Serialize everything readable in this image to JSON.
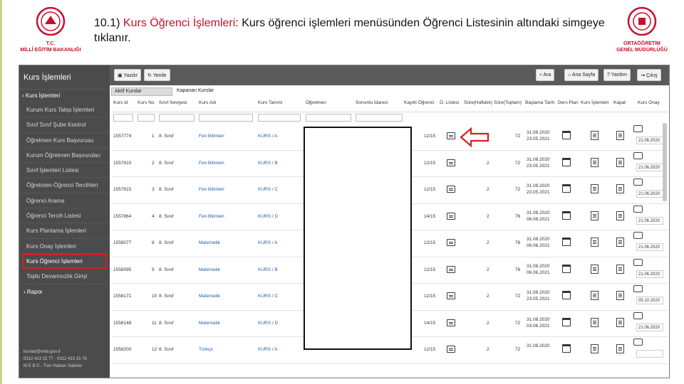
{
  "slide": {
    "headline_number": "10.1)",
    "headline_highlight": "Kurs Öğrenci İşlemleri",
    "headline_rest": ": Kurs öğrenci işlemleri menüsünden Öğrenci Listesinin altındaki simgeye tıklanır.",
    "logo_left_text1": "T.C.",
    "logo_left_text2": "MİLLÎ EĞİTİM BAKANLIĞI",
    "logo_right_text1": "ORTAÖĞRETİM",
    "logo_right_text2": "GENEL MÜDÜRLÜĞÜ"
  },
  "sidebar": {
    "title": "Kurs İşlemleri",
    "group": "Kurs İşlemleri",
    "items": [
      "Kurum Kurs Talep İşlemleri",
      "Sınıf Sınıf Şube Kontrol",
      "Öğretmen Kurs Başvurusu",
      "Kurum Öğretmen Başvuruları",
      "Sınıf İşlemleri Listesi",
      "Öğretmen-Öğrenci Tercihleri",
      "Öğrenci Arama",
      "Öğrenci Tercih Listesi",
      "Kurs Planlama İşlemleri",
      "Kurs Onay İşlemleri",
      "Kurs Öğrenci İşlemleri",
      "Toplu Devamsızlık Girişi"
    ],
    "active_index": 10,
    "rapor": "Rapor",
    "footer1": "kurslar@meb.gov.tr",
    "footer2": "0312 413 15 77 · 0312 413 15 78",
    "footer3": "M E B © - Tüm Hakları Saklıdır"
  },
  "toolbar": {
    "yazdir": "Yazdır",
    "yenile": "Yenile",
    "ara": "Ara",
    "ana_sayfa": "Ana Sayfa",
    "yardim": "Yardım",
    "cikis": "Çıkış"
  },
  "tabs": [
    "Aktif Kurslar",
    "Kapanan Kurslar"
  ],
  "table": {
    "headers": [
      "Kurs Id",
      "Kurs No",
      "Sınıf Seviyesi",
      "Kurs Adı",
      "Kurs Tanımı",
      "Öğretmen",
      "Sorumlu İdareci",
      "Kayıtlı Öğrenci",
      "Ö. Listesi",
      "Süre(Haftalık)",
      "Süre(Toplam)",
      "Başlama Tarih",
      "Ders Plan",
      "Kurs İşlemleri",
      "Kapat",
      "Kurs Onay"
    ],
    "rows": [
      {
        "id": "1557774",
        "no": "1",
        "seviye": "8. Sınıf",
        "ad": "Fen Bilimleri",
        "tanim": "KURS / A",
        "kayitli": "12/15",
        "haftalik": "2",
        "toplam": "72",
        "bas": "31.08.2020",
        "bit": "23.05.2021",
        "kapat": "21.06.2020"
      },
      {
        "id": "1557810",
        "no": "2",
        "seviye": "8. Sınıf",
        "ad": "Fen Bilimleri",
        "tanim": "KURS / B",
        "kayitli": "12/15",
        "haftalik": "2",
        "toplam": "72",
        "bas": "31.08.2020",
        "bit": "23.05.2021",
        "kapat": "21.06.2020"
      },
      {
        "id": "1557815",
        "no": "3",
        "seviye": "8. Sınıf",
        "ad": "Fen Bilimleri",
        "tanim": "KURS / C",
        "kayitli": "12/15",
        "haftalik": "2",
        "toplam": "72",
        "bas": "31.08.2020",
        "bit": "23.05.2021",
        "kapat": "21.06.2020"
      },
      {
        "id": "1557864",
        "no": "4",
        "seviye": "8. Sınıf",
        "ad": "Fen Bilimleri",
        "tanim": "KURS / D",
        "kayitli": "14/15",
        "haftalik": "2",
        "toplam": "76",
        "bas": "31.08.2020",
        "bit": "06.06.2021",
        "kapat": "21.06.2020"
      },
      {
        "id": "1558077",
        "no": "8",
        "seviye": "8. Sınıf",
        "ad": "Matematik",
        "tanim": "KURS / A",
        "kayitli": "12/15",
        "haftalik": "2",
        "toplam": "76",
        "bas": "31.08.2020",
        "bit": "06.06.2021",
        "kapat": "21.06.2020"
      },
      {
        "id": "1558095",
        "no": "9",
        "seviye": "8. Sınıf",
        "ad": "Matematik",
        "tanim": "KURS / B",
        "kayitli": "12/15",
        "haftalik": "2",
        "toplam": "76",
        "bas": "31.08.2020",
        "bit": "06.06.2021",
        "kapat": "21.06.2020"
      },
      {
        "id": "1558171",
        "no": "10",
        "seviye": "8. Sınıf",
        "ad": "Matematik",
        "tanim": "KURS / C",
        "kayitli": "12/15",
        "haftalik": "2",
        "toplam": "72",
        "bas": "31.08.2020",
        "bit": "23.05.2021",
        "kapat": "05.10.2020"
      },
      {
        "id": "1558148",
        "no": "11",
        "seviye": "8. Sınıf",
        "ad": "Matematik",
        "tanim": "KURS / D",
        "kayitli": "14/15",
        "haftalik": "2",
        "toplam": "72",
        "bas": "31.08.2020",
        "bit": "03.06.2021",
        "kapat": "21.06.2020"
      },
      {
        "id": "1558200",
        "no": "12",
        "seviye": "8. Sınıf",
        "ad": "Türkçe",
        "tanim": "KURS / A",
        "kayitli": "12/15",
        "haftalik": "2",
        "toplam": "72",
        "bas": "31.08.2020",
        "bit": "",
        "kapat": ""
      }
    ]
  }
}
